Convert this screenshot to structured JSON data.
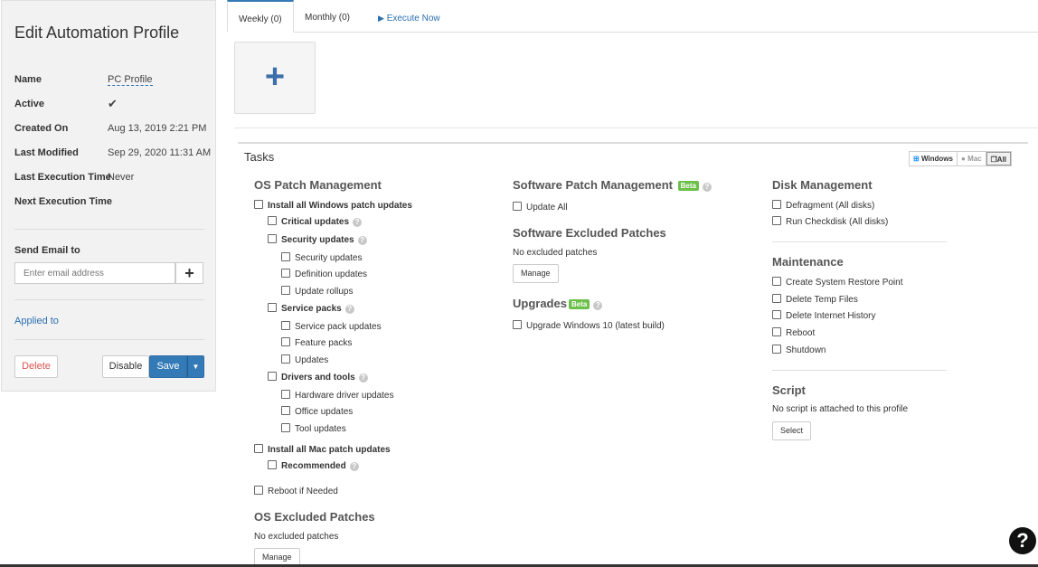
{
  "panel": {
    "title": "Edit Automation Profile",
    "fields": {
      "name_label": "Name",
      "name_value": "PC Profile",
      "active_label": "Active",
      "active_icon": "checkmark-icon",
      "created_label": "Created On",
      "created_value": "Aug 13, 2019 2:21 PM",
      "modified_label": "Last Modified",
      "modified_value": "Sep 29, 2020 11:31 AM",
      "last_exec_label": "Last Execution Time",
      "last_exec_value": "Never",
      "next_exec_label": "Next Execution Time"
    },
    "send_email_label": "Send Email to",
    "email_placeholder": "Enter email address",
    "applied_to": "Applied to",
    "delete": "Delete",
    "disable": "Disable",
    "save": "Save"
  },
  "tabs": {
    "weekly": "Weekly (0)",
    "monthly": "Monthly (0)",
    "execute": "Execute Now"
  },
  "tasks": {
    "title": "Tasks",
    "os_toggle": {
      "windows": "Windows",
      "mac": "Mac",
      "all": "All"
    },
    "os_patch": {
      "title": "OS Patch Management",
      "install_windows": "Install all Windows patch updates",
      "critical": "Critical updates",
      "security": "Security updates",
      "security_updates": "Security updates",
      "definition_updates": "Definition updates",
      "update_rollups": "Update rollups",
      "service_packs": "Service packs",
      "service_pack_updates": "Service pack updates",
      "feature_packs": "Feature packs",
      "updates": "Updates",
      "drivers_tools": "Drivers and tools",
      "hardware_driver_updates": "Hardware driver updates",
      "office_updates": "Office updates",
      "tool_updates": "Tool updates",
      "install_mac": "Install all Mac patch updates",
      "recommended": "Recommended",
      "reboot_if_needed": "Reboot if Needed"
    },
    "os_excluded": {
      "title": "OS Excluded Patches",
      "text": "No excluded patches",
      "manage": "Manage"
    },
    "software_patch": {
      "title": "Software Patch Management",
      "beta": "Beta",
      "update_all": "Update All"
    },
    "software_excluded": {
      "title": "Software Excluded Patches",
      "text": "No excluded patches",
      "manage": "Manage"
    },
    "upgrades": {
      "title": "Upgrades",
      "beta": "Beta",
      "upgrade_win10": "Upgrade Windows 10 (latest build)"
    },
    "disk": {
      "title": "Disk Management",
      "defragment": "Defragment (All disks)",
      "checkdisk": "Run Checkdisk (All disks)"
    },
    "maintenance": {
      "title": "Maintenance",
      "restore_point": "Create System Restore Point",
      "temp_files": "Delete Temp Files",
      "internet_history": "Delete Internet History",
      "reboot": "Reboot",
      "shutdown": "Shutdown"
    },
    "script": {
      "title": "Script",
      "text": "No script is attached to this profile",
      "select": "Select"
    }
  },
  "help": "?"
}
